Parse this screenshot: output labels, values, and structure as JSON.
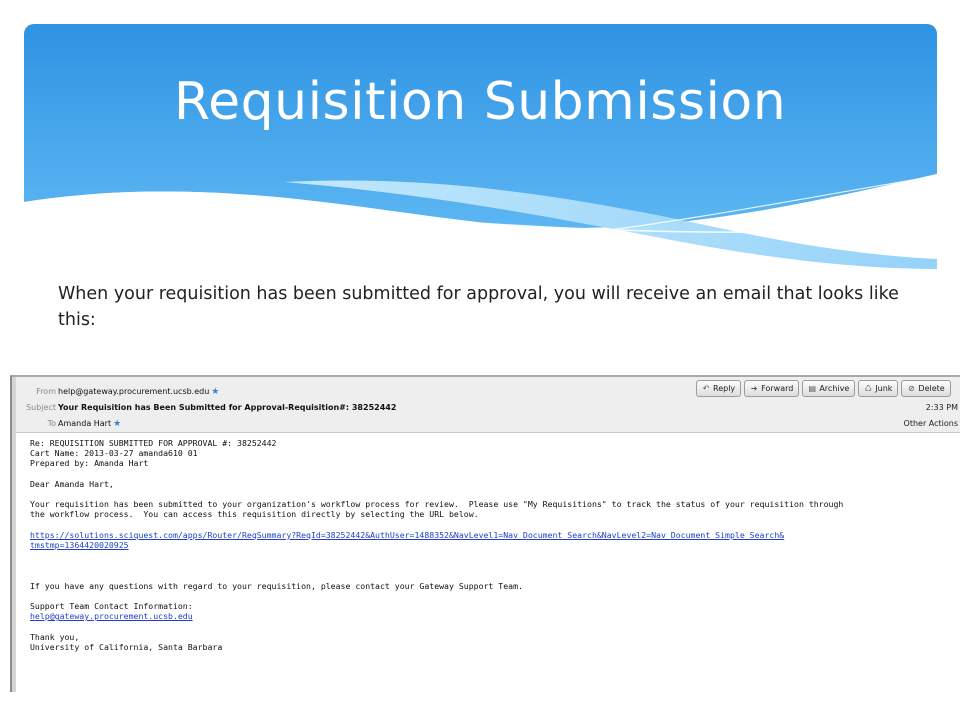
{
  "slide": {
    "title": "Requisition Submission",
    "intro_text": "When your requisition has been submitted for approval, you will receive an email that looks like this:"
  },
  "colors": {
    "header_top": "#2f93e3",
    "header_bottom": "#5cb6f2",
    "wave_light": "#a6dafb"
  },
  "email": {
    "header": {
      "from_label": "From",
      "from_value": "help@gateway.procurement.ucsb.edu",
      "subject_label": "Subject",
      "subject_value": "Your Requisition has Been Submitted for Approval-Requisition#: 38252442",
      "to_label": "To",
      "to_value": "Amanda Hart",
      "time": "2:33 PM",
      "other_actions": "Other Actions"
    },
    "toolbar": {
      "reply": "Reply",
      "forward": "Forward",
      "archive": "Archive",
      "junk": "Junk",
      "delete": "Delete"
    },
    "body": {
      "line1": "Re: REQUISITION SUBMITTED FOR APPROVAL #: 38252442",
      "line2": "Cart Name: 2013-03-27 amanda610 01",
      "line3": "Prepared by: Amanda Hart",
      "greeting": "Dear Amanda Hart,",
      "para1_line1": "Your requisition has been submitted to your organization's workflow process for review.  Please use \"My Requisitions\" to track the status of your requisition through",
      "para1_line2": "the workflow process.  You can access this requisition directly by selecting the URL below.",
      "url_line1": "https://solutions.sciquest.com/apps/Router/ReqSummary?ReqId=38252442&AuthUser=1488352&NavLevel1=Nav_Document_Search&NavLevel2=Nav_Document_Simple_Search&",
      "url_line2": "tmstmp=1364420020925",
      "questions": "If you have any questions with regard to your requisition, please contact your Gateway Support Team.",
      "support_heading": "Support Team Contact Information:",
      "support_email": "help@gateway.procurement.ucsb.edu",
      "thanks": "Thank you,",
      "signature": "University of California, Santa Barbara"
    }
  }
}
